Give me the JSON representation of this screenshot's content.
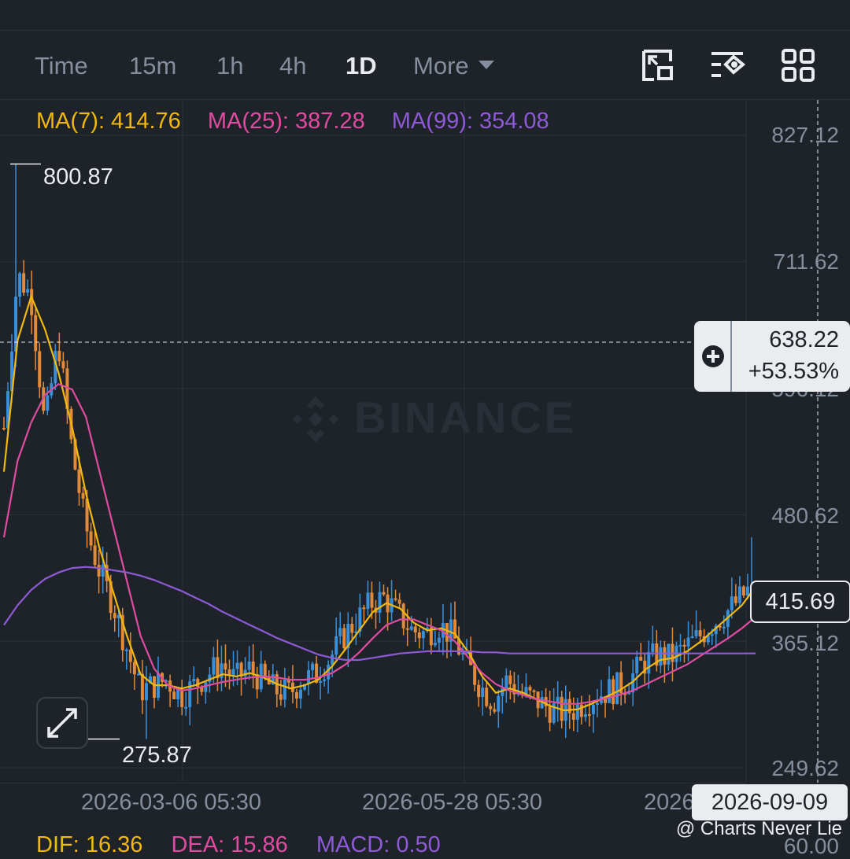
{
  "toolbar": {
    "tabs": [
      {
        "label": "Time"
      },
      {
        "label": "15m"
      },
      {
        "label": "1h"
      },
      {
        "label": "4h"
      },
      {
        "label": "1D"
      },
      {
        "label": "More"
      }
    ],
    "active_tab": "1D",
    "icons": [
      "fullscreen-chart-icon",
      "indicator-settings-icon",
      "layout-grid-icon"
    ]
  },
  "ma_legend": {
    "ma7": "MA(7): 414.76",
    "ma25": "MA(25): 387.28",
    "ma99": "MA(99): 354.08"
  },
  "watermark": "BINANCE",
  "y_axis": {
    "ticks": [
      "827.12",
      "711.62",
      "596.12",
      "480.62",
      "365.12",
      "249.62"
    ]
  },
  "crosshair": {
    "price": "638.22",
    "change": "+53.53%",
    "date": "2026-09-09"
  },
  "last_price": "415.69",
  "high_label": "800.87",
  "low_label": "275.87",
  "x_axis": {
    "ticks": [
      "2026-03-06 05:30",
      "2026-05-28 05:30",
      "2026-"
    ]
  },
  "macd_legend": {
    "dif": "DIF: 16.36",
    "dea": "DEA: 15.86",
    "macd": "MACD: 0.50"
  },
  "macd_axis_value": "60.00",
  "credit": "@ Charts Never Lie",
  "colors": {
    "up": "#3a8fd9",
    "down": "#e08a3a",
    "ma7": "#f0b90b",
    "ma25": "#e04ca0",
    "ma99": "#8e5ad6",
    "background": "#1e2329"
  },
  "chart_data": {
    "type": "candlestick",
    "interval": "1D",
    "high": 800.87,
    "low": 275.87,
    "last": 415.69,
    "ylim": [
      249.62,
      827.12
    ],
    "y_ticks": [
      827.12,
      711.62,
      596.12,
      480.62,
      365.12,
      249.62
    ],
    "x_ticks": [
      "2026-03-06 05:30",
      "2026-05-28 05:30"
    ],
    "crosshair": {
      "date": "2026-09-09",
      "price": 638.22,
      "change_pct": 53.53
    },
    "close_path": [
      560,
      700,
      680,
      560,
      640,
      540,
      470,
      430,
      400,
      360,
      320,
      325,
      330,
      315,
      325,
      335,
      345,
      330,
      340,
      330,
      320,
      318,
      330,
      335,
      350,
      370,
      385,
      400,
      405,
      390,
      375,
      372,
      380,
      370,
      345,
      325,
      310,
      330,
      318,
      312,
      305,
      300,
      303,
      312,
      318,
      322,
      330,
      345,
      352,
      350,
      358,
      368,
      380,
      390,
      402,
      415
    ],
    "series": [
      {
        "name": "MA(7)",
        "last": 414.76,
        "values": [
          520,
          640,
          680,
          650,
          610,
          560,
          500,
          450,
          410,
          370,
          335,
          325,
          325,
          322,
          325,
          330,
          335,
          333,
          336,
          332,
          326,
          322,
          325,
          330,
          342,
          358,
          375,
          392,
          400,
          395,
          382,
          375,
          377,
          372,
          355,
          333,
          318,
          322,
          318,
          312,
          306,
          302,
          303,
          308,
          314,
          320,
          328,
          340,
          348,
          350,
          356,
          365,
          376,
          387,
          398,
          414.76
        ]
      },
      {
        "name": "MA(25)",
        "last": 387.28,
        "values": [
          460,
          530,
          565,
          590,
          600,
          595,
          570,
          520,
          470,
          420,
          370,
          340,
          325,
          320,
          322,
          325,
          328,
          330,
          332,
          333,
          332,
          330,
          330,
          332,
          336,
          344,
          355,
          368,
          380,
          385,
          385,
          380,
          375,
          365,
          350,
          336,
          326,
          320,
          316,
          312,
          310,
          308,
          308,
          310,
          313,
          316,
          320,
          326,
          332,
          338,
          344,
          352,
          360,
          368,
          377,
          387.28
        ]
      },
      {
        "name": "MA(99)",
        "last": 354.08,
        "values": [
          380,
          398,
          412,
          422,
          428,
          432,
          433,
          432,
          430,
          428,
          425,
          421,
          416,
          411,
          405,
          399,
          392,
          386,
          380,
          374,
          368,
          363,
          358,
          353,
          350,
          348,
          348,
          350,
          352,
          354,
          355,
          356,
          356,
          356,
          356,
          355,
          355,
          354,
          354,
          354,
          354,
          354,
          354,
          354,
          354,
          354,
          354,
          354,
          354,
          354,
          354,
          354,
          354,
          354,
          354,
          354.08
        ]
      }
    ]
  }
}
